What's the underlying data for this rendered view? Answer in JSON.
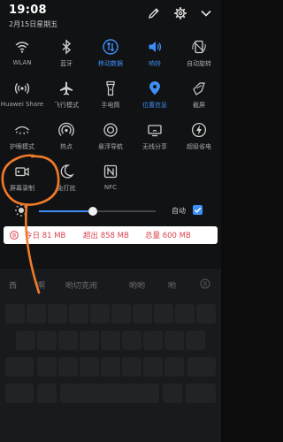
{
  "status": {
    "time": "19:08",
    "date": "2月15日星期五"
  },
  "tiles": [
    {
      "label": "WLAN",
      "icon": "wifi-icon",
      "active": false
    },
    {
      "label": "蓝牙",
      "icon": "bluetooth-icon",
      "active": false
    },
    {
      "label": "移动数据",
      "icon": "mobile-data-icon",
      "active": true
    },
    {
      "label": "响铃",
      "icon": "ring-icon",
      "active": true
    },
    {
      "label": "自动旋转",
      "icon": "auto-rotate-icon",
      "active": false
    },
    {
      "label": "Huawei Share",
      "icon": "huawei-share-icon",
      "active": false
    },
    {
      "label": "飞行模式",
      "icon": "airplane-icon",
      "active": false
    },
    {
      "label": "手电筒",
      "icon": "flashlight-icon",
      "active": false
    },
    {
      "label": "位置信息",
      "icon": "location-icon",
      "active": true
    },
    {
      "label": "截屏",
      "icon": "screenshot-icon",
      "active": false
    },
    {
      "label": "护眼模式",
      "icon": "eye-comfort-icon",
      "active": false
    },
    {
      "label": "热点",
      "icon": "hotspot-icon",
      "active": false
    },
    {
      "label": "悬浮导航",
      "icon": "floating-nav-icon",
      "active": false
    },
    {
      "label": "无线分享",
      "icon": "wireless-share-icon",
      "active": false
    },
    {
      "label": "超级省电",
      "icon": "power-saving-icon",
      "active": false
    },
    {
      "label": "屏幕录制",
      "icon": "screen-record-icon",
      "active": false
    },
    {
      "label": "免打扰",
      "icon": "do-not-disturb-icon",
      "active": false
    },
    {
      "label": "NFC",
      "icon": "nfc-icon",
      "active": false
    }
  ],
  "brightness": {
    "level": 0.46,
    "auto_label": "自动",
    "auto_enabled": true
  },
  "usage": {
    "today": "今日 81 MB",
    "over": "超出 858 MB",
    "total": "总量 600 MB"
  },
  "keyboard": {
    "suggestions": [
      "西",
      "啊",
      "哟切克闹",
      "哟哟",
      "哟"
    ]
  },
  "colors": {
    "accent": "#3d8ff5",
    "usage_text": "#d8434e",
    "annotation": "#f07a2a"
  }
}
